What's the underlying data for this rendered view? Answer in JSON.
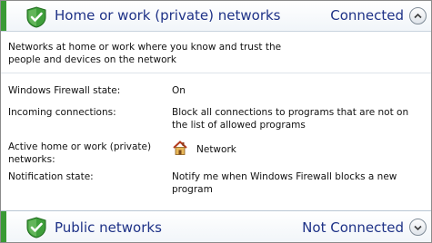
{
  "private_section": {
    "title": "Home or work (private) networks",
    "status": "Connected",
    "description": "Networks at home or work where you know and trust the people and devices on the network",
    "rows": [
      {
        "label": "Windows Firewall state:",
        "value": "On"
      },
      {
        "label": "Incoming connections:",
        "value": "Block all connections to programs that are not on the list of allowed programs"
      },
      {
        "label": "Active home or work (private) networks:",
        "value": "Network"
      },
      {
        "label": "Notification state:",
        "value": "Notify me when Windows Firewall blocks a new program"
      }
    ]
  },
  "public_section": {
    "title": "Public networks",
    "status": "Not Connected"
  },
  "icons": {
    "shield": "shield-check-icon",
    "house": "home-network-icon",
    "collapse": "chevron-up-icon",
    "expand": "chevron-down-icon"
  },
  "colors": {
    "accent_green": "#3a9a35",
    "header_text": "#1e3287"
  }
}
